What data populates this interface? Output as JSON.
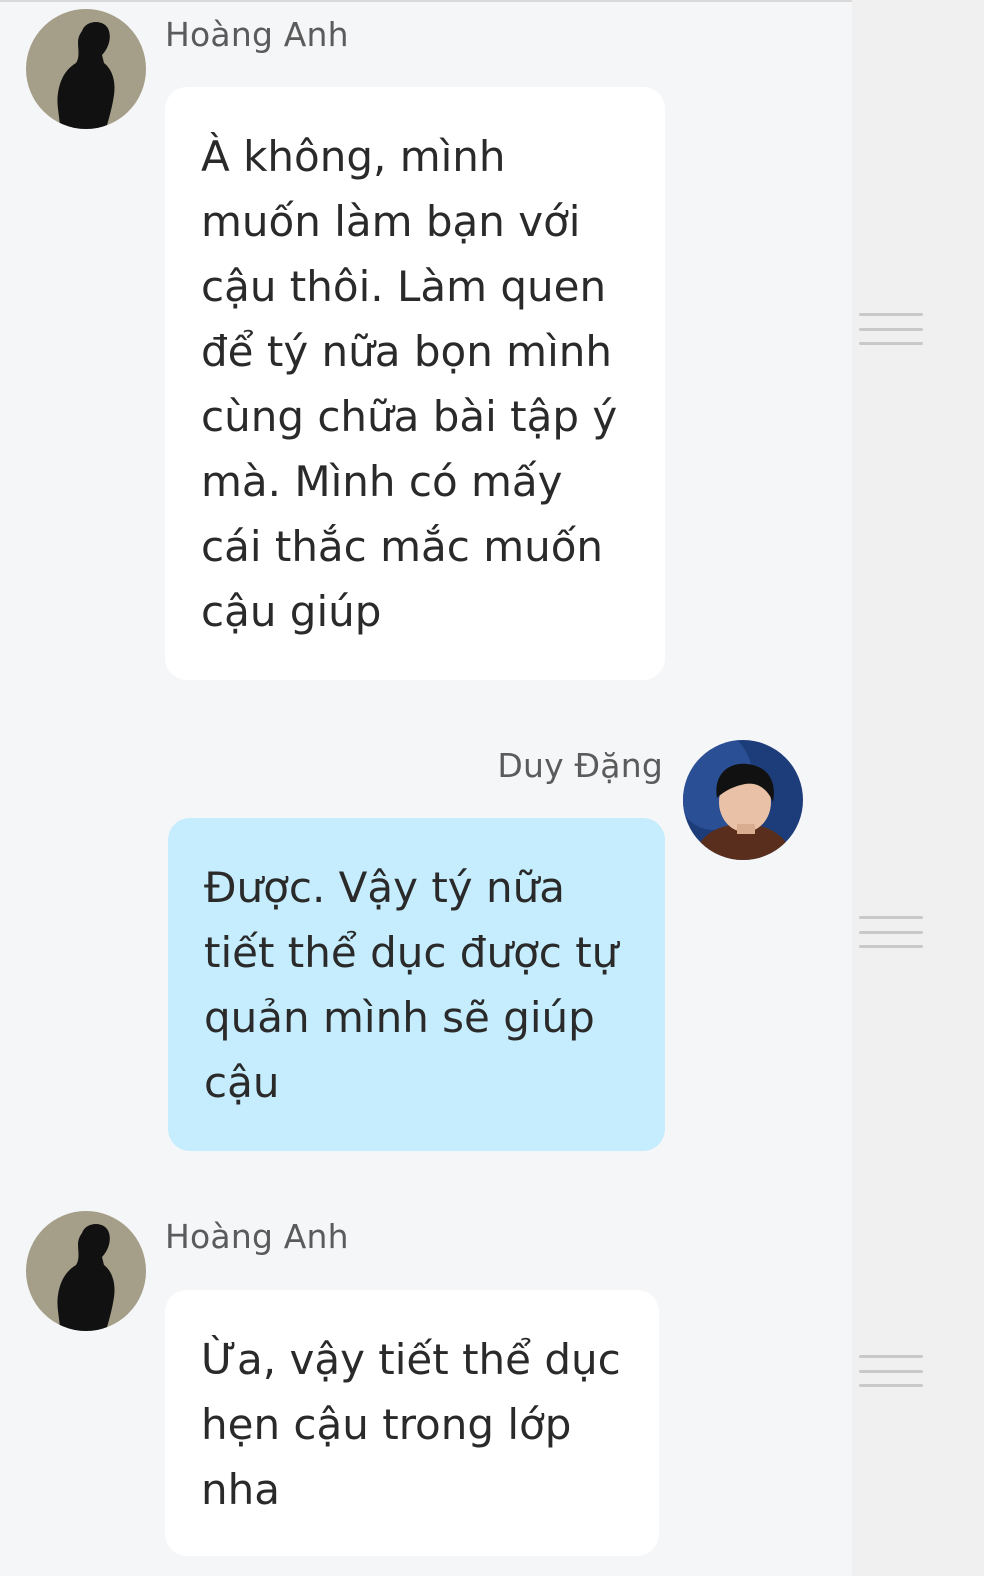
{
  "messages": [
    {
      "direction": "incoming",
      "sender": "Hoàng Anh",
      "avatar_icon": "silhouette-avatar-icon",
      "text": "À không, mình\nmuốn làm bạn với\ncậu thôi. Làm quen\nđể tý nữa bọn mình\ncùng chữa bài tập ý\nmà. Mình có mấy\ncái thắc mắc muốn\ncậu giúp"
    },
    {
      "direction": "outgoing",
      "sender": "Duy Đặng",
      "avatar_icon": "photo-avatar-icon",
      "text": "Được. Vậy tý nữa\ntiết thể dục được tự\nquản mình sẽ giúp\ncậu"
    },
    {
      "direction": "incoming",
      "sender": "Hoàng Anh",
      "avatar_icon": "silhouette-avatar-icon",
      "text": "Ừa, vậy tiết thể dục\nhẹn cậu trong lớp\nnha"
    }
  ],
  "colors": {
    "background": "#f5f6f8",
    "incoming_bubble": "#ffffff",
    "outgoing_bubble": "#c5edfd",
    "name_text": "#5b5b5b",
    "message_text": "#2a2a2a",
    "side_panel": "#f0f0f0",
    "handle": "#c9c9c9"
  },
  "icons": {
    "drag_handle": "hamburger-drag-icon"
  }
}
